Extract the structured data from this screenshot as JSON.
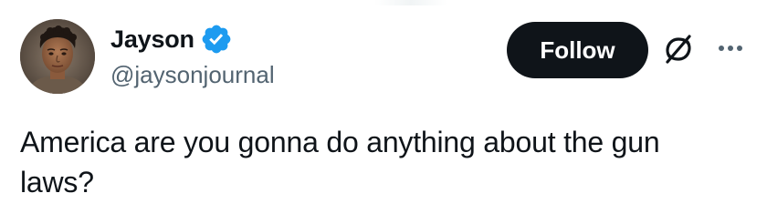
{
  "tweet": {
    "author": {
      "display_name": "Jayson",
      "handle": "@jaysonjournal",
      "verified": true,
      "verified_color": "#1d9bf0",
      "avatar_icon": "user-avatar"
    },
    "follow_label": "Follow",
    "icons": {
      "grok": "grok-icon",
      "more": "more-icon"
    },
    "text": "America are you gonna do anything about the gun\nlaws?"
  },
  "colors": {
    "text_primary": "#0f1419",
    "text_secondary": "#536471",
    "follow_bg": "#0f1419",
    "follow_fg": "#ffffff"
  }
}
